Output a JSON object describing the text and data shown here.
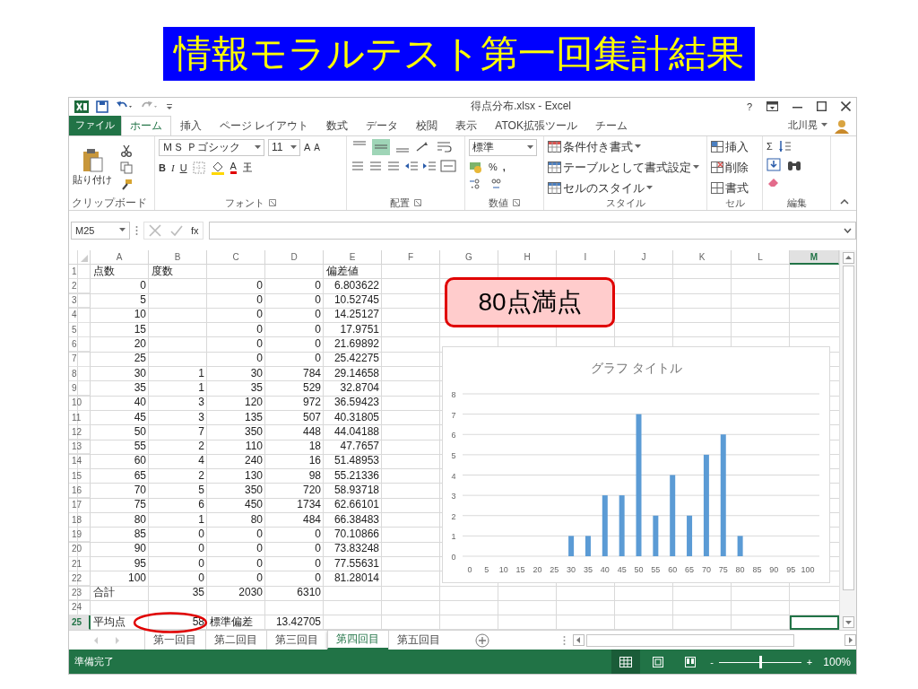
{
  "slide_title": "情報モラルテスト第一回集計結果",
  "window": {
    "title": "得点分布.xlsx - Excel",
    "help": "?"
  },
  "ribbon_tabs": {
    "file": "ファイル",
    "user": "北川晃",
    "tabs": [
      {
        "label": "ホーム",
        "selected": true
      },
      {
        "label": "挿入",
        "selected": false
      },
      {
        "label": "ページ レイアウト",
        "selected": false
      },
      {
        "label": "数式",
        "selected": false
      },
      {
        "label": "データ",
        "selected": false
      },
      {
        "label": "校閲",
        "selected": false
      },
      {
        "label": "表示",
        "selected": false
      },
      {
        "label": "ATOK拡張ツール",
        "selected": false
      },
      {
        "label": "チーム",
        "selected": false
      }
    ]
  },
  "ribbon": {
    "clipboard": {
      "paste": "貼り付け",
      "label": "クリップボード"
    },
    "font": {
      "name": "ＭＳ Ｐゴシック",
      "size": "11",
      "grow": "A",
      "shrink": "A",
      "bold": "B",
      "italic": "I",
      "underline": "U",
      "font_color_glyph": "A",
      "label": "フォント"
    },
    "alignment": {
      "label": "配置",
      "vertical": [
        {
          "selected": false
        },
        {
          "selected": true
        },
        {
          "selected": false
        }
      ]
    },
    "number": {
      "format": "標準",
      "percent": "%",
      "comma": ",",
      "label": "数値"
    },
    "styles": {
      "items": [
        "条件付き書式",
        "テーブルとして書式設定",
        "セルのスタイル"
      ],
      "label": "スタイル"
    },
    "cells": {
      "items": [
        "挿入",
        "削除",
        "書式"
      ],
      "label": "セル"
    },
    "editing": {
      "sum": "Σ",
      "label": "編集"
    }
  },
  "formula_bar": {
    "name_box": "M25",
    "fx": "fx"
  },
  "sheet": {
    "columns": [
      {
        "label": "A",
        "selected": false
      },
      {
        "label": "B",
        "selected": false
      },
      {
        "label": "C",
        "selected": false
      },
      {
        "label": "D",
        "selected": false
      },
      {
        "label": "E",
        "selected": false
      },
      {
        "label": "F",
        "selected": false
      },
      {
        "label": "G",
        "selected": false
      },
      {
        "label": "H",
        "selected": false
      },
      {
        "label": "I",
        "selected": false
      },
      {
        "label": "J",
        "selected": false
      },
      {
        "label": "K",
        "selected": false
      },
      {
        "label": "L",
        "selected": false
      },
      {
        "label": "M",
        "selected": true
      }
    ],
    "rows": [
      {
        "header": "1",
        "selected": false,
        "cells": [
          "点数",
          "度数",
          null,
          null,
          "偏差値"
        ]
      },
      {
        "header": "2",
        "selected": false,
        "cells": [
          "0",
          null,
          "0",
          "0",
          "6.803622"
        ]
      },
      {
        "header": "3",
        "selected": false,
        "cells": [
          "5",
          null,
          "0",
          "0",
          "10.52745"
        ]
      },
      {
        "header": "4",
        "selected": false,
        "cells": [
          "10",
          null,
          "0",
          "0",
          "14.25127"
        ]
      },
      {
        "header": "5",
        "selected": false,
        "cells": [
          "15",
          null,
          "0",
          "0",
          "17.9751"
        ]
      },
      {
        "header": "6",
        "selected": false,
        "cells": [
          "20",
          null,
          "0",
          "0",
          "21.69892"
        ]
      },
      {
        "header": "7",
        "selected": false,
        "cells": [
          "25",
          null,
          "0",
          "0",
          "25.42275"
        ]
      },
      {
        "header": "8",
        "selected": false,
        "cells": [
          "30",
          "1",
          "30",
          "784",
          "29.14658"
        ]
      },
      {
        "header": "9",
        "selected": false,
        "cells": [
          "35",
          "1",
          "35",
          "529",
          "32.8704"
        ]
      },
      {
        "header": "10",
        "selected": false,
        "cells": [
          "40",
          "3",
          "120",
          "972",
          "36.59423"
        ]
      },
      {
        "header": "11",
        "selected": false,
        "cells": [
          "45",
          "3",
          "135",
          "507",
          "40.31805"
        ]
      },
      {
        "header": "12",
        "selected": false,
        "cells": [
          "50",
          "7",
          "350",
          "448",
          "44.04188"
        ]
      },
      {
        "header": "13",
        "selected": false,
        "cells": [
          "55",
          "2",
          "110",
          "18",
          "47.7657"
        ]
      },
      {
        "header": "14",
        "selected": false,
        "cells": [
          "60",
          "4",
          "240",
          "16",
          "51.48953"
        ]
      },
      {
        "header": "15",
        "selected": false,
        "cells": [
          "65",
          "2",
          "130",
          "98",
          "55.21336"
        ]
      },
      {
        "header": "16",
        "selected": false,
        "cells": [
          "70",
          "5",
          "350",
          "720",
          "58.93718"
        ]
      },
      {
        "header": "17",
        "selected": false,
        "cells": [
          "75",
          "6",
          "450",
          "1734",
          "62.66101"
        ]
      },
      {
        "header": "18",
        "selected": false,
        "cells": [
          "80",
          "1",
          "80",
          "484",
          "66.38483"
        ]
      },
      {
        "header": "19",
        "selected": false,
        "cells": [
          "85",
          "0",
          "0",
          "0",
          "70.10866"
        ]
      },
      {
        "header": "20",
        "selected": false,
        "cells": [
          "90",
          "0",
          "0",
          "0",
          "73.83248"
        ]
      },
      {
        "header": "21",
        "selected": false,
        "cells": [
          "95",
          "0",
          "0",
          "0",
          "77.55631"
        ]
      },
      {
        "header": "22",
        "selected": false,
        "cells": [
          "100",
          "0",
          "0",
          "0",
          "81.28014"
        ]
      },
      {
        "header": "23",
        "selected": false,
        "cells": [
          "合計",
          "35",
          "2030",
          "6310"
        ]
      },
      {
        "header": "24",
        "selected": false,
        "cells": []
      },
      {
        "header": "25",
        "selected": true,
        "cells": [
          "平均点",
          "58",
          "標準偏差",
          "13.42705"
        ]
      }
    ]
  },
  "callout": "80点満点",
  "chart": {
    "chart_data": {
      "type": "bar",
      "title": "グラフ タイトル",
      "categories": [
        "0",
        "5",
        "10",
        "15",
        "20",
        "25",
        "30",
        "35",
        "40",
        "45",
        "50",
        "55",
        "60",
        "65",
        "70",
        "75",
        "80",
        "85",
        "90",
        "95",
        "100"
      ],
      "series": [
        {
          "color": "#5b9bd5",
          "values": [
            0,
            0,
            0,
            0,
            0,
            0,
            1,
            1,
            3,
            3,
            7,
            2,
            4,
            2,
            5,
            6,
            1,
            0,
            0,
            0,
            0
          ]
        }
      ],
      "ylim": [
        0,
        8
      ],
      "yticks": [
        0,
        1,
        2,
        3,
        4,
        5,
        6,
        7,
        8
      ],
      "grid": true
    }
  },
  "sheet_tabs": [
    {
      "label": "第一回目",
      "selected": false
    },
    {
      "label": "第二回目",
      "selected": false
    },
    {
      "label": "第三回目",
      "selected": false
    },
    {
      "label": "第四回目",
      "selected": true
    },
    {
      "label": "第五回目",
      "selected": false
    }
  ],
  "status_bar": {
    "status": "準備完了",
    "zoom_out": "-",
    "zoom_in": "+",
    "zoom": {
      "level": 0.5
    },
    "zoom_label": "100%"
  }
}
